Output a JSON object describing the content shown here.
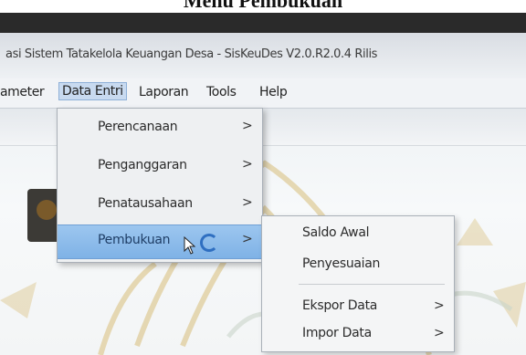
{
  "caption": {
    "text": "Menu Pembukuan"
  },
  "window": {
    "title": "asi Sistem Tatakelola Keuangan Desa - SisKeuDes V2.0.R2.0.4 Rilis"
  },
  "menubar": {
    "items": [
      {
        "label": "ameter"
      },
      {
        "label": "Data Entri"
      },
      {
        "label": "Laporan"
      },
      {
        "label": "Tools"
      },
      {
        "label": "Help"
      }
    ]
  },
  "data_entri_menu": {
    "items": [
      {
        "label": "Perencanaan",
        "arrow": ">"
      },
      {
        "label": "Penganggaran",
        "arrow": ">"
      },
      {
        "label": "Penatausahaan",
        "arrow": ">"
      },
      {
        "label": "Pembukuan",
        "arrow": ">"
      }
    ]
  },
  "pembukuan_submenu": {
    "items": [
      {
        "label": "Saldo Awal",
        "arrow": ""
      },
      {
        "label": "Penyesuaian",
        "arrow": ""
      },
      {
        "label": "Ekspor Data",
        "arrow": ">"
      },
      {
        "label": "Impor Data",
        "arrow": ">"
      }
    ]
  },
  "colors": {
    "highlight": "#7fb2e6",
    "menu_bg": "#eef0f2",
    "watermark": "#d4b25a"
  },
  "icons": {
    "loading": "spinner-icon",
    "cursor": "mouse-pointer-icon",
    "app_logo": "app-logo-icon"
  }
}
